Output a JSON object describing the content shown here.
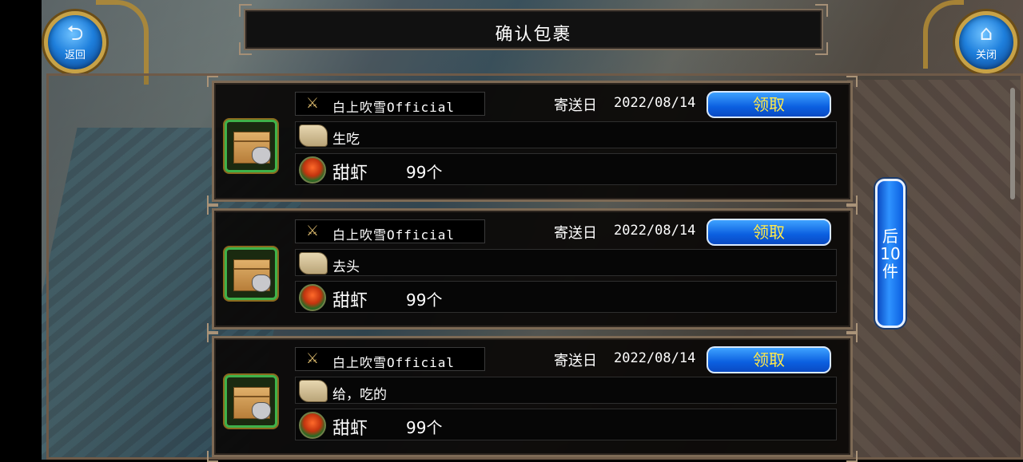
{
  "header": {
    "title": "确认包裹",
    "back_label": "返回",
    "close_label": "关闭"
  },
  "icons": {
    "back": "return-arrow-icon",
    "close": "home-icon",
    "sender": "crossed-swords-icon",
    "message": "scroll-icon",
    "item": "sweet-shrimp-icon",
    "parcel": "parcel-box-icon"
  },
  "colors": {
    "claim_text": "#ffe94a",
    "button_blue": "#1e7fdc",
    "frame_gold": "#c7a247"
  },
  "parcels": [
    {
      "sender": "白上吹雪Official",
      "date_label": "寄送日",
      "date": "2022/08/14",
      "claim_label": "领取",
      "message": "生吃",
      "item_name": "甜虾",
      "item_qty": "99个"
    },
    {
      "sender": "白上吹雪Official",
      "date_label": "寄送日",
      "date": "2022/08/14",
      "claim_label": "领取",
      "message": "去头",
      "item_name": "甜虾",
      "item_qty": "99个"
    },
    {
      "sender": "白上吹雪Official",
      "date_label": "寄送日",
      "date": "2022/08/14",
      "claim_label": "领取",
      "message": "给，吃的",
      "item_name": "甜虾",
      "item_qty": "99个"
    }
  ],
  "pager": {
    "next_chars": [
      "后",
      "10",
      "件"
    ]
  }
}
